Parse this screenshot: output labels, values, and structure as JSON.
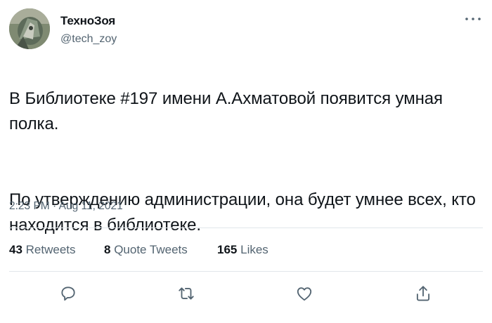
{
  "user": {
    "display_name": "ТехноЗоя",
    "handle": "@tech_zoy",
    "avatar": "avatar-photo"
  },
  "tweet": {
    "paragraphs": [
      "В Библиотеке #197 имени А.Ахматовой появится умная полка.",
      "По утверждению администрации, она будет умнее всех, кто находится в библиотеке."
    ],
    "timestamp": "2:23 PM · Aug 11, 2021"
  },
  "stats": [
    {
      "count": "43",
      "label": "Retweets"
    },
    {
      "count": "8",
      "label": "Quote Tweets"
    },
    {
      "count": "165",
      "label": "Likes"
    }
  ],
  "actions": [
    {
      "icon": "reply-icon"
    },
    {
      "icon": "retweet-icon"
    },
    {
      "icon": "like-icon"
    },
    {
      "icon": "share-icon"
    }
  ],
  "colors": {
    "text": "#0f1419",
    "secondary": "#536471",
    "icon": "#536471",
    "divider": "#e1e6ea"
  }
}
